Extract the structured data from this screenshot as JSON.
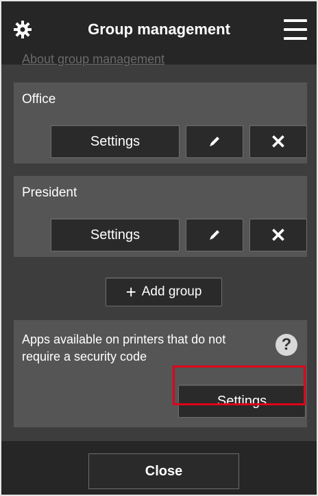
{
  "header": {
    "title": "Group management",
    "settings_icon": "gear-icon",
    "menu_icon": "hamburger-menu-icon"
  },
  "about_link": "About group management",
  "groups": [
    {
      "name": "Office",
      "settings_label": "Settings",
      "edit_icon": "pencil-icon",
      "delete_label": "✕"
    },
    {
      "name": "President",
      "settings_label": "Settings",
      "edit_icon": "pencil-icon",
      "delete_label": "✕"
    }
  ],
  "add_group": {
    "icon": "+",
    "label": "Add group"
  },
  "security": {
    "text": "Apps available on printers that do not require a security code",
    "help_icon": "?",
    "settings_label": "Settings"
  },
  "footer": {
    "close_label": "Close"
  },
  "colors": {
    "highlight": "#e0001a",
    "header": "#262626",
    "panel": "#555555"
  }
}
